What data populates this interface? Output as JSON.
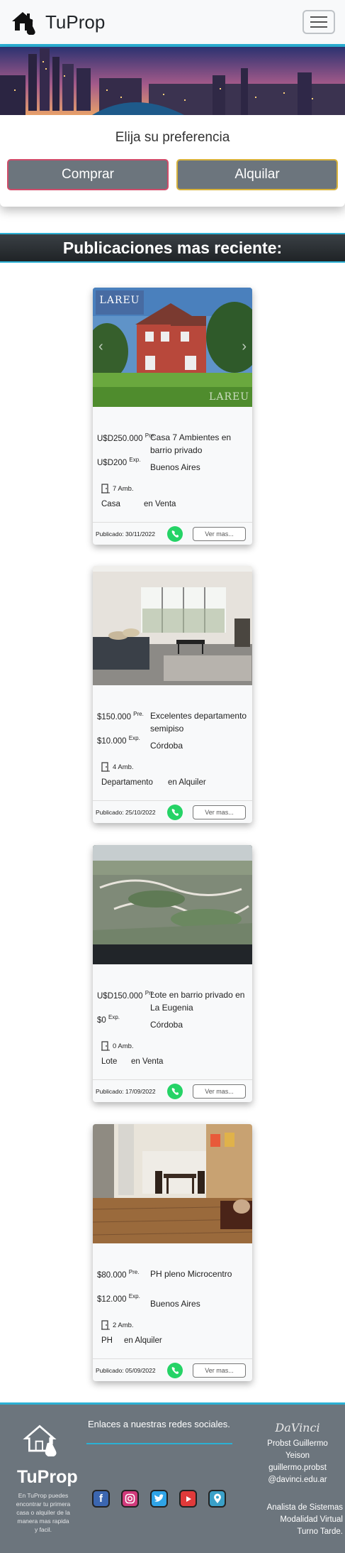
{
  "navbar": {
    "brand": "TuProp",
    "logo_icon": "house-hand-icon",
    "menu_icon": "hamburger-icon"
  },
  "hero": {
    "prompt": "Elija su preferencia",
    "buy_label": "Comprar",
    "rent_label": "Alquilar"
  },
  "section": {
    "title": "Publicaciones mas reciente:"
  },
  "listings": [
    {
      "price_sale": "U$D250.000",
      "price_sale_tag": "Pre.",
      "price_exp": "U$D200",
      "price_exp_tag": "Exp.",
      "title": "Casa 7 Ambientes en barrio privado",
      "location": "Buenos Aires",
      "rooms": "7 Amb.",
      "type": "Casa",
      "operation": "en Venta",
      "published": "Publicado: 30/11/2022",
      "more": "Ver mas...",
      "watermark": "LAREU"
    },
    {
      "price_sale": "$150.000",
      "price_sale_tag": "Pre.",
      "price_exp": "$10.000",
      "price_exp_tag": "Exp.",
      "title": "Excelentes departamento semipiso",
      "location": "Córdoba",
      "rooms": "4 Amb.",
      "type": "Departamento",
      "operation": "en Alquiler",
      "published": "Publicado: 25/10/2022",
      "more": "Ver mas..."
    },
    {
      "price_sale": "U$D150.000",
      "price_sale_tag": "Pre.",
      "price_exp": "$0",
      "price_exp_tag": "Exp.",
      "title": "Lote en barrio privado en La Eugenia",
      "location": "Córdoba",
      "rooms": "0 Amb.",
      "type": "Lote",
      "operation": "en Venta",
      "published": "Publicado: 17/09/2022",
      "more": "Ver mas..."
    },
    {
      "price_sale": "$80.000",
      "price_sale_tag": "Pre.",
      "price_exp": "$12.000",
      "price_exp_tag": "Exp.",
      "title": "PH pleno Microcentro",
      "location": "Buenos Aires",
      "rooms": "2 Amb.",
      "type": "PH",
      "operation": "en Alquiler",
      "published": "Publicado: 05/09/2022",
      "more": "Ver mas..."
    }
  ],
  "footer": {
    "brand": "TuProp",
    "description": "En TuProp puedes encontrar tu primera casa o alquiler de la manera mas rapida y facil.",
    "links_title": "Enlaces a nuestras redes sociales.",
    "social_icons": [
      "facebook-icon",
      "instagram-icon",
      "twitter-icon",
      "youtube-icon",
      "location-icon"
    ],
    "school": "DaVinci",
    "author": "Probst Guillermo Yeison",
    "email": "guillermo.probst @davinci.edu.ar",
    "course": "Analista de Sistemas Modalidad Virtual Turno Tarde."
  },
  "colors": {
    "accent": "#2bb0d4",
    "button_gray": "#6c757d",
    "buy_border": "#d04c6a",
    "rent_border": "#d8b23a",
    "whatsapp": "#25d366"
  }
}
